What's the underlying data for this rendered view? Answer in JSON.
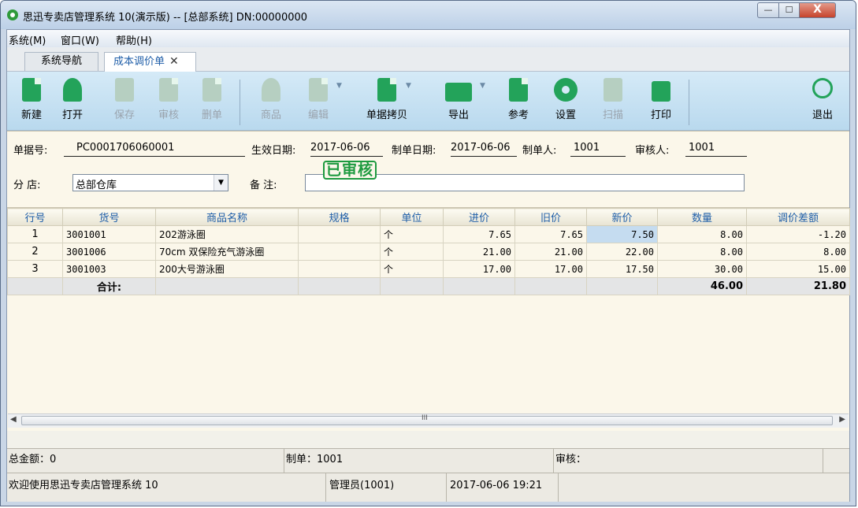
{
  "window": {
    "title": "思迅专卖店管理系统 10(演示版) -- [总部系统] DN:00000000",
    "min_label": "—",
    "max_label": "☐",
    "close_label": "X"
  },
  "menu": {
    "items": [
      "系统(M)",
      "窗口(W)",
      "帮助(H)"
    ]
  },
  "tabs": [
    {
      "label": "系统导航"
    },
    {
      "label": "成本调价单",
      "close": "✕"
    }
  ],
  "toolbar": {
    "items": [
      {
        "label": "新建",
        "icon": "new-doc-icon",
        "enabled": true
      },
      {
        "label": "打开",
        "icon": "open-envelope-icon",
        "enabled": true
      },
      {
        "label": "保存",
        "icon": "save-icon",
        "enabled": false
      },
      {
        "label": "审核",
        "icon": "audit-icon",
        "enabled": false
      },
      {
        "label": "删单",
        "icon": "delete-doc-icon",
        "enabled": false
      },
      {
        "label": "商品",
        "icon": "goods-basket-icon",
        "enabled": false
      },
      {
        "label": "编辑",
        "icon": "edit-icon",
        "enabled": false
      },
      {
        "label": "单据拷贝",
        "icon": "copy-doc-icon",
        "enabled": true
      },
      {
        "label": "导出",
        "icon": "export-folder-icon",
        "enabled": true
      },
      {
        "label": "参考",
        "icon": "reference-icon",
        "enabled": true
      },
      {
        "label": "设置",
        "icon": "gear-icon",
        "enabled": true
      },
      {
        "label": "扫描",
        "icon": "scan-icon",
        "enabled": false
      },
      {
        "label": "打印",
        "icon": "printer-icon",
        "enabled": true
      },
      {
        "label": "退出",
        "icon": "power-icon",
        "enabled": true
      }
    ]
  },
  "form": {
    "doc_no_label": "单据号:",
    "doc_no": "PC0001706060001",
    "effective_label": "生效日期:",
    "effective_date": "2017-06-06",
    "made_label": "制单日期:",
    "made_date": "2017-06-06",
    "maker_label": "制单人:",
    "maker": "1001",
    "auditor_label": "审核人:",
    "auditor": "1001",
    "branch_label": "分  店:",
    "branch": "总部仓库",
    "note_label": "备  注:",
    "note": "",
    "stamp": "已审核"
  },
  "grid": {
    "columns": [
      "行号",
      "货号",
      "商品名称",
      "规格",
      "单位",
      "进价",
      "旧价",
      "新价",
      "数量",
      "调价差额"
    ],
    "rows": [
      [
        "1",
        "3001001",
        "202游泳圈",
        "",
        "个",
        "7.65",
        "7.65",
        "7.50",
        "8.00",
        "-1.20"
      ],
      [
        "2",
        "3001006",
        "70cm 双保险充气游泳圈",
        "",
        "个",
        "21.00",
        "21.00",
        "22.00",
        "8.00",
        "8.00"
      ],
      [
        "3",
        "3001003",
        "200大号游泳圈",
        "",
        "个",
        "17.00",
        "17.00",
        "17.50",
        "30.00",
        "15.00"
      ]
    ],
    "total_label": "合计:",
    "total_qty": "46.00",
    "total_diff": "21.80",
    "scroll_grip": "III"
  },
  "status1": {
    "total_amount": "总金额：0",
    "maker": "制单：1001",
    "auditor": "审核："
  },
  "status2": {
    "welcome": "欢迎使用思迅专卖店管理系统 10",
    "user": "管理员(1001)",
    "datetime": "2017-06-06 19:21"
  },
  "colors": {
    "accent": "#1f5ea8",
    "toolbar_green": "#23a35a",
    "stamp_green": "#1d9a3f"
  }
}
